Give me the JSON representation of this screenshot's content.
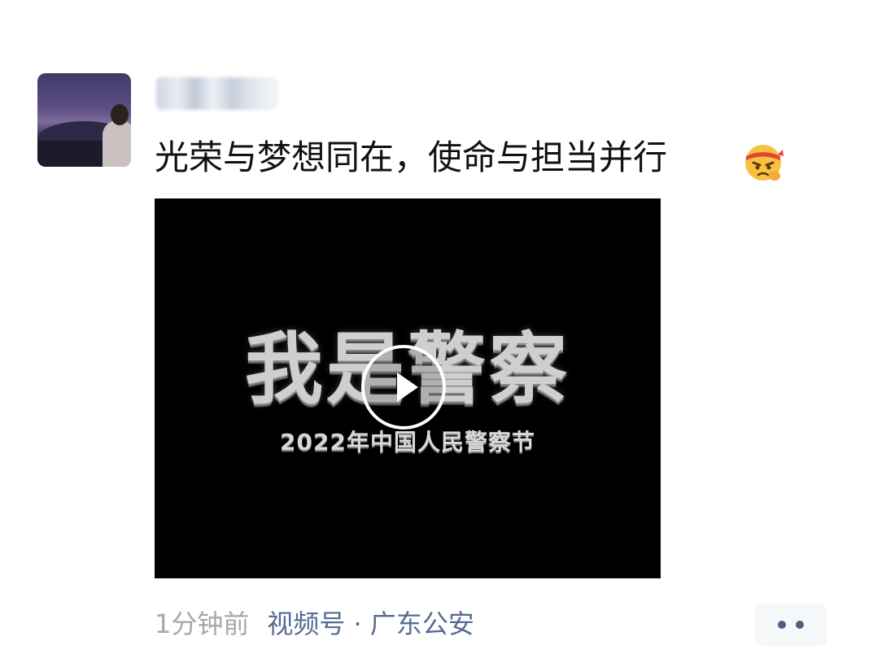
{
  "post": {
    "caption": "光荣与梦想同在，使命与担当并行",
    "emoji_icon": "angry-headband-emoji-icon",
    "video": {
      "title": "我是警察",
      "subtitle": "2022年中国人民警察节",
      "play_icon": "play-icon"
    },
    "meta": {
      "time": "1分钟前",
      "source": "视频号 · 广东公安"
    },
    "more_icon": "more-dots-icon"
  },
  "colors": {
    "link": "#576b95",
    "time": "#a8a8a8",
    "text": "#111111"
  }
}
